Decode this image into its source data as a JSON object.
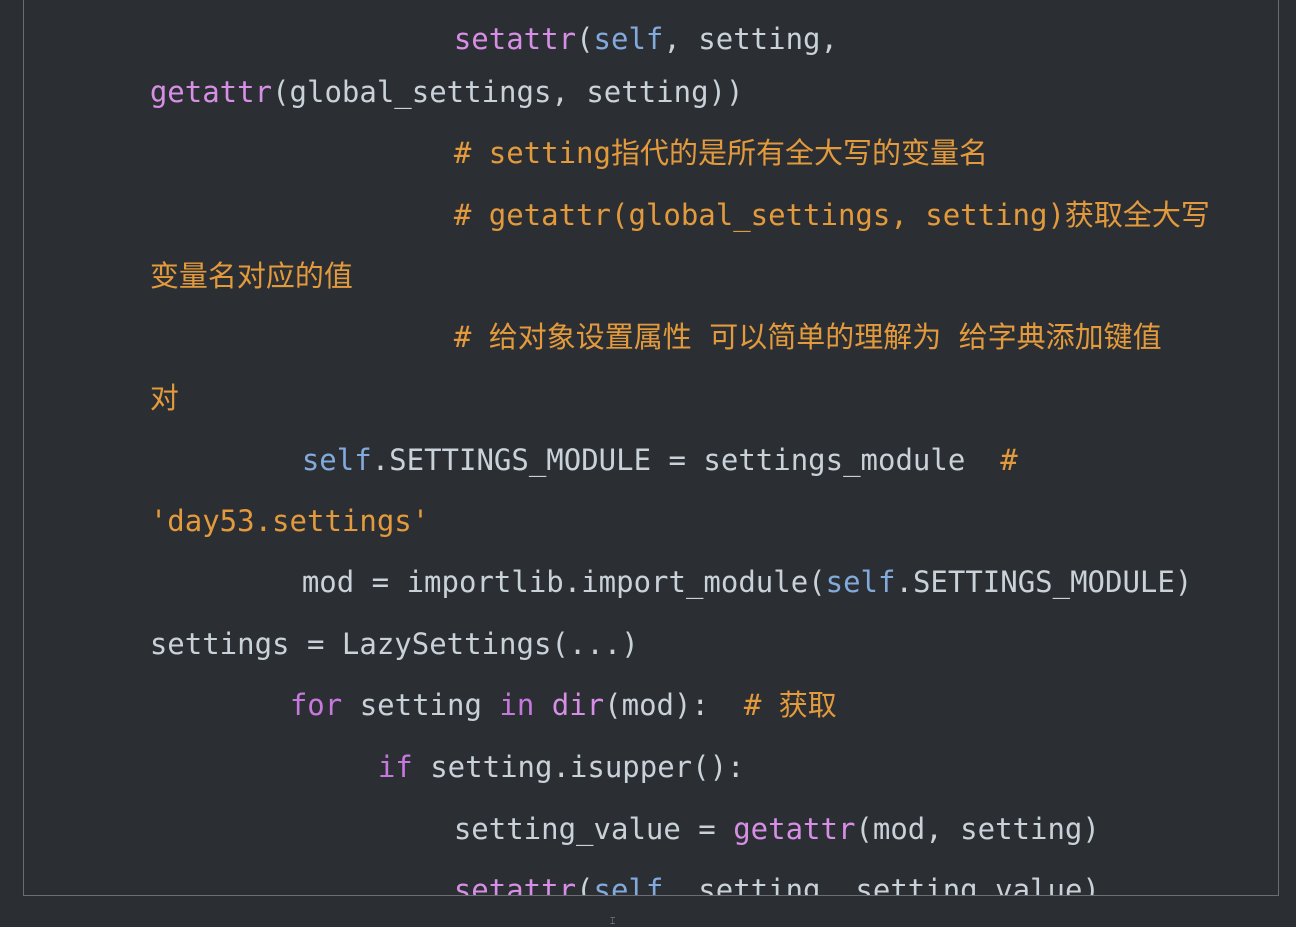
{
  "code": {
    "lines": [
      {
        "segments": [
          {
            "t": "setattr",
            "c": "fn"
          },
          {
            "t": "(",
            "c": "plain"
          },
          {
            "t": "self",
            "c": "self"
          },
          {
            "t": ", setting,",
            "c": "plain"
          }
        ]
      },
      {
        "segments": [
          {
            "t": "getattr",
            "c": "fn"
          },
          {
            "t": "(global_settings, setting))",
            "c": "plain"
          }
        ]
      },
      {
        "segments": [
          {
            "t": "# setting指代的是所有全大写的变量名",
            "c": "comment"
          }
        ]
      },
      {
        "segments": [
          {
            "t": "# getattr(global_settings, setting)获取全大写",
            "c": "comment"
          }
        ]
      },
      {
        "segments": [
          {
            "t": "变量名对应的值",
            "c": "comment"
          }
        ]
      },
      {
        "segments": [
          {
            "t": "# 给对象设置属性 可以简单的理解为 给字典添加键值",
            "c": "comment"
          }
        ]
      },
      {
        "segments": [
          {
            "t": "对",
            "c": "comment"
          }
        ]
      },
      {
        "segments": [
          {
            "t": "self",
            "c": "self"
          },
          {
            "t": ".SETTINGS_MODULE = settings_module  ",
            "c": "plain"
          },
          {
            "t": "#",
            "c": "comment"
          }
        ]
      },
      {
        "segments": [
          {
            "t": "'day53.settings'",
            "c": "string"
          }
        ]
      },
      {
        "segments": [
          {
            "t": "mod = importlib.import_module(",
            "c": "plain"
          },
          {
            "t": "self",
            "c": "self"
          },
          {
            "t": ".SETTINGS_MODULE)",
            "c": "plain"
          }
        ]
      },
      {
        "segments": [
          {
            "t": "settings = LazySettings(...)",
            "c": "plain"
          }
        ]
      },
      {
        "segments": [
          {
            "t": "for",
            "c": "kw"
          },
          {
            "t": " setting ",
            "c": "plain"
          },
          {
            "t": "in",
            "c": "kw"
          },
          {
            "t": " ",
            "c": "plain"
          },
          {
            "t": "dir",
            "c": "fn"
          },
          {
            "t": "(mod):  ",
            "c": "plain"
          },
          {
            "t": "# 获取",
            "c": "comment"
          }
        ]
      },
      {
        "segments": [
          {
            "t": "if",
            "c": "kw"
          },
          {
            "t": " setting.isupper():",
            "c": "plain"
          }
        ]
      },
      {
        "segments": [
          {
            "t": "setting_value = ",
            "c": "plain"
          },
          {
            "t": "getattr",
            "c": "fn"
          },
          {
            "t": "(mod, setting)",
            "c": "plain"
          }
        ]
      },
      {
        "segments": [
          {
            "t": "setattr",
            "c": "fn"
          },
          {
            "t": "(",
            "c": "plain"
          },
          {
            "t": "self",
            "c": "self"
          },
          {
            "t": ", setting, setting_value)",
            "c": "plain"
          }
        ]
      }
    ]
  },
  "colors": {
    "background": "#2b2f33",
    "border": "#6a6e72",
    "function": "#d78fe6",
    "keyword": "#c678dd",
    "self": "#82aadc",
    "comment": "#e39a3c",
    "text": "#c9d1d9"
  },
  "cursor_icon": "text-cursor-icon"
}
